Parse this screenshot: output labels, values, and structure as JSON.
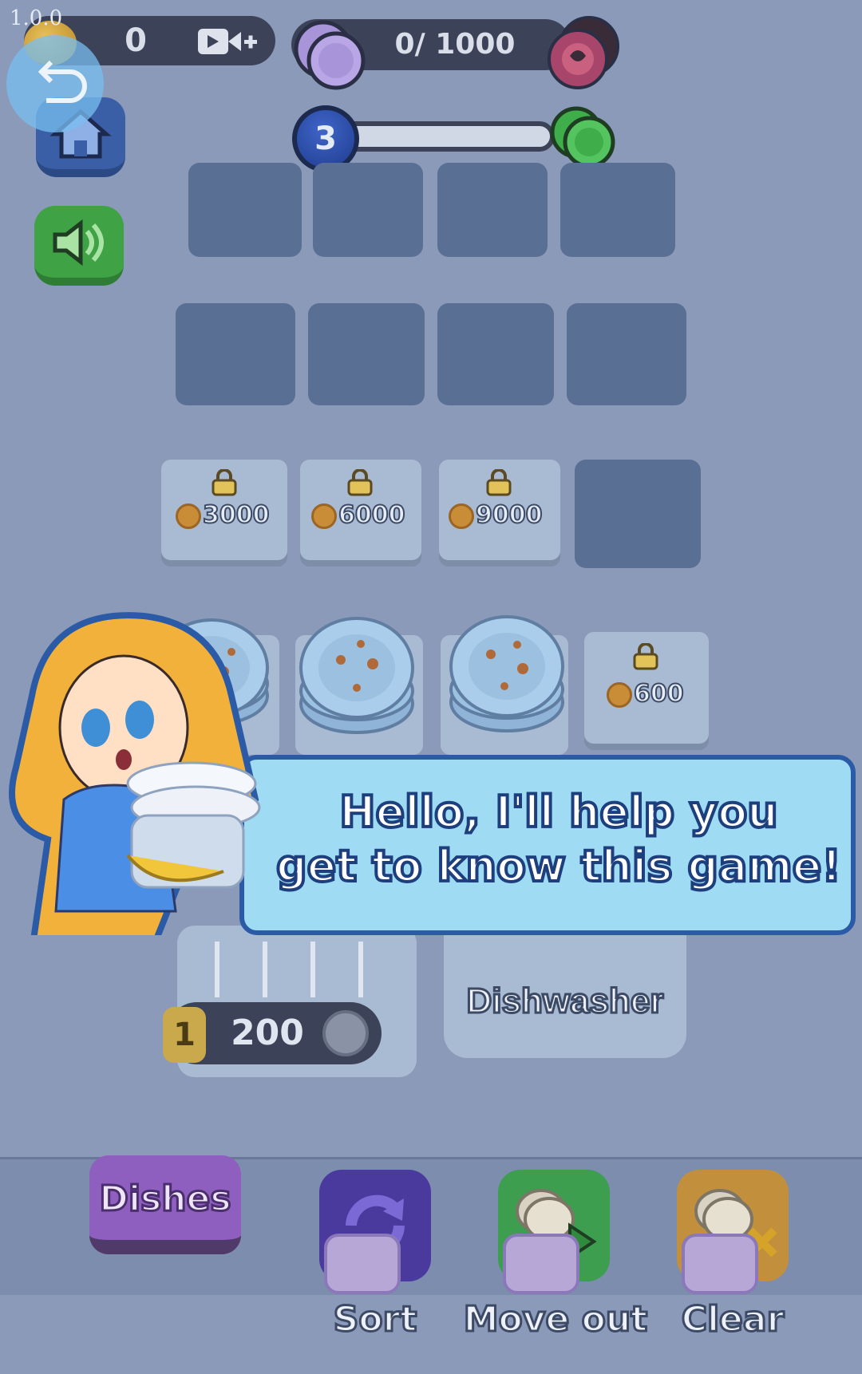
{
  "version": "1.0.0",
  "header": {
    "coins": "0",
    "plates_progress": "0/ 1000",
    "level": "3"
  },
  "locked_slots": [
    "3000",
    "6000",
    "9000"
  ],
  "locked_stack_price": "600",
  "tutorial": {
    "line1": "Hello, I'll help you",
    "line2": "get to know this game!"
  },
  "rack": {
    "level": "1",
    "price": "200"
  },
  "dishwasher_label": "Dishwasher",
  "toolbar": {
    "dishes": "Dishes",
    "sort": "Sort",
    "move_out": "Move out",
    "clear": "Clear"
  },
  "icons": [
    "back-icon",
    "home-icon",
    "sound-icon",
    "video-plus-icon",
    "plate-stack-icon",
    "chip-icon",
    "green-plates-icon",
    "lock-icon",
    "coin-icon",
    "sort-icon",
    "move-out-icon",
    "clear-icon"
  ]
}
